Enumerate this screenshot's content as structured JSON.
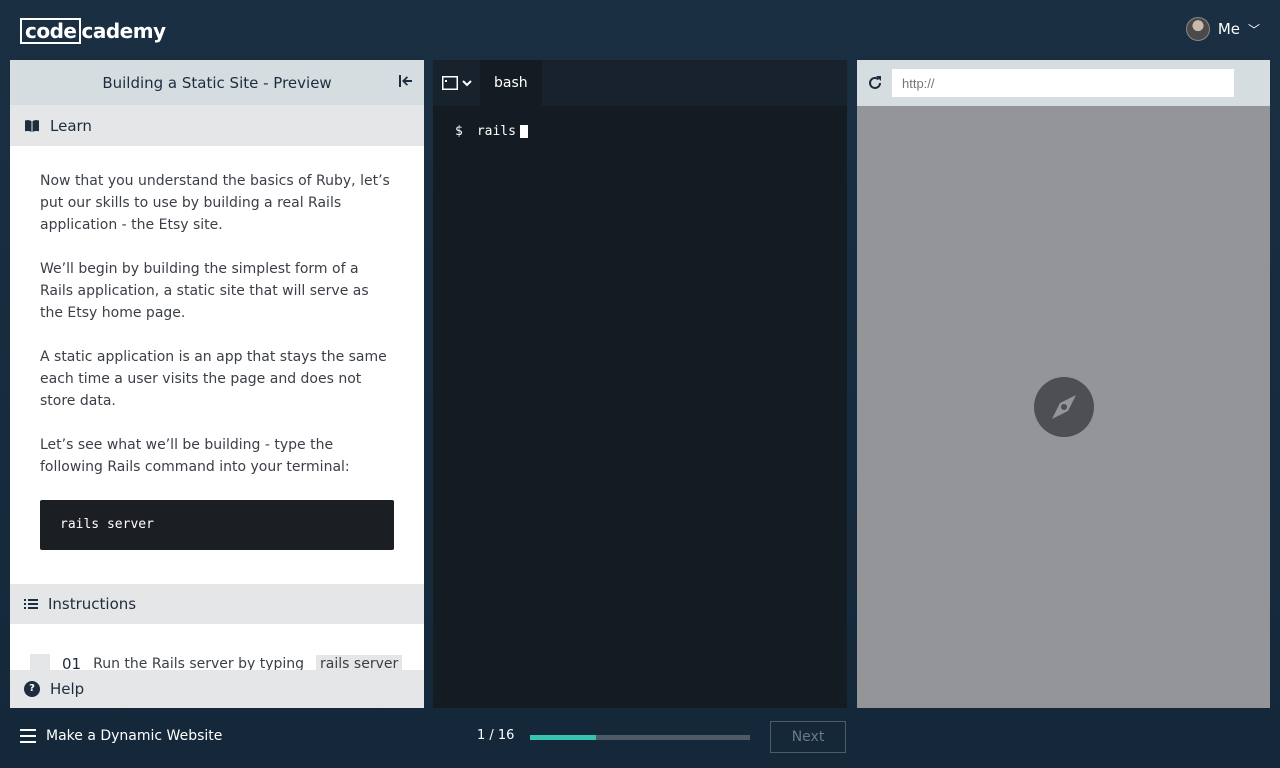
{
  "header": {
    "logo_code": "code",
    "logo_rest": "cademy",
    "user_name": "Me"
  },
  "lesson": {
    "title": "Building a Static Site - Preview",
    "learn_label": "Learn",
    "paragraphs": [
      "Now that you understand the basics of Ruby, let’s put our skills to use by building a real Rails application - the Etsy site.",
      "We’ll begin by building the simplest form of a Rails application, a static site that will serve as the Etsy home page.",
      "A static application is an app that stays the same each time a user visits the page and does not store data.",
      "Let’s see what we’ll be building - type the following Rails command into your terminal:"
    ],
    "code": "rails server",
    "instructions_label": "Instructions",
    "task_number": "01",
    "task_text": "Run the Rails server by typing",
    "task_code": "rails server",
    "help_label": "Help"
  },
  "terminal": {
    "tab_label": "bash",
    "prompt": "$",
    "command": "rails"
  },
  "browser": {
    "url_placeholder": "http://"
  },
  "footer": {
    "course_title": "Make a Dynamic Website",
    "progress_text": "1 / 16",
    "progress_fraction": 0.3,
    "next_label": "Next"
  },
  "colors": {
    "accent": "#37c3b0",
    "background": "#17273a"
  }
}
